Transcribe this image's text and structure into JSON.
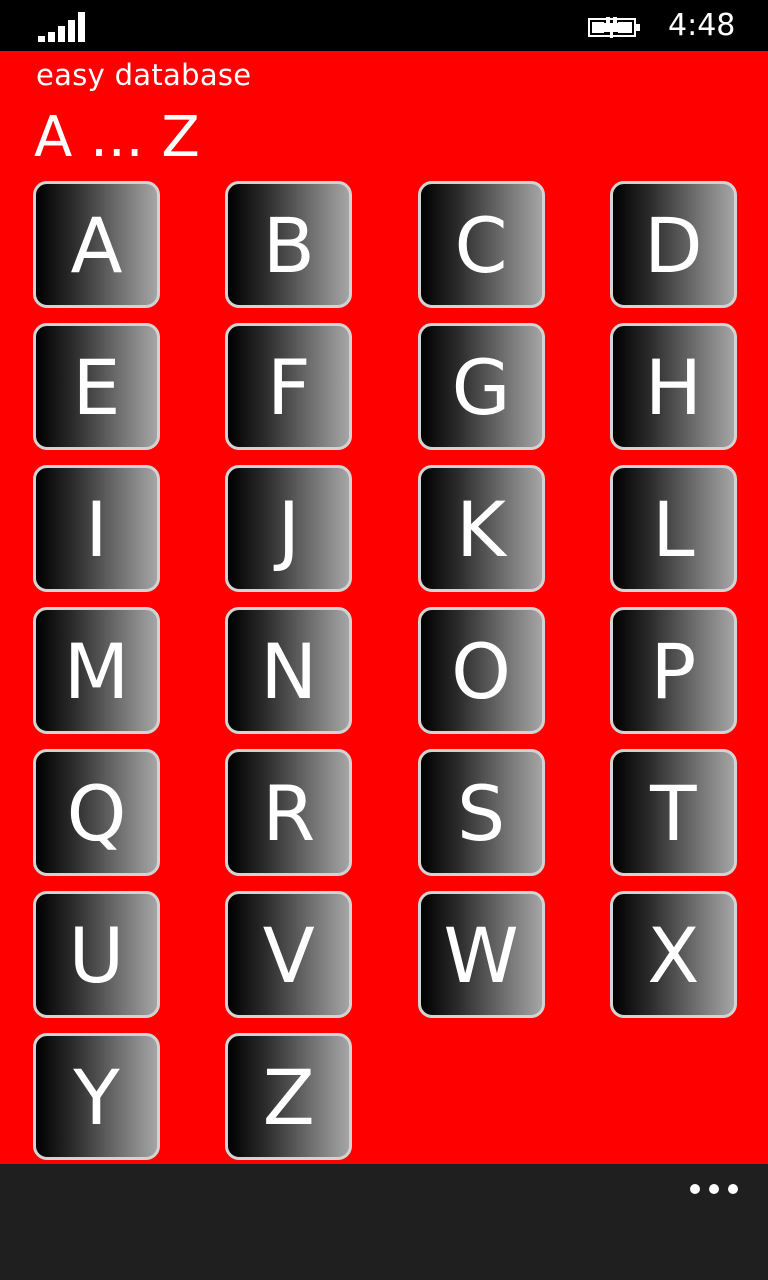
{
  "status_bar": {
    "time": "4:48",
    "signal_icon": "signal-strength-icon",
    "battery_icon": "battery-charging-icon"
  },
  "header": {
    "app_title": "easy database",
    "page_title": "A ... Z"
  },
  "letters": [
    "A",
    "B",
    "C",
    "D",
    "E",
    "F",
    "G",
    "H",
    "I",
    "J",
    "K",
    "L",
    "M",
    "N",
    "O",
    "P",
    "Q",
    "R",
    "S",
    "T",
    "U",
    "V",
    "W",
    "X",
    "Y",
    "Z"
  ],
  "app_bar": {
    "more_icon": "more-ellipsis-icon"
  },
  "colors": {
    "background": "#ff0000",
    "tile_border": "#d3d3d3",
    "app_bar": "#1f1f1f"
  }
}
